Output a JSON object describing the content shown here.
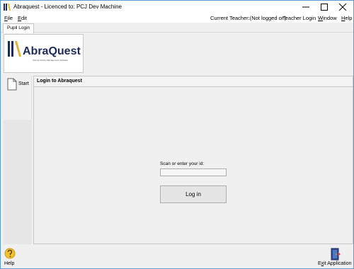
{
  "window": {
    "title": "Abraquest - Licenced to: PCJ Dev Machine"
  },
  "menu": {
    "file_rest": "ile",
    "file_mnemonic": "F",
    "edit_rest": "dit",
    "edit_mnemonic": "E",
    "current_teacher": "Current Teacher:(Not logged on)",
    "teacher_login": "Teacher Login",
    "window_rest": "indow",
    "window_mnemonic": "W",
    "help_rest": "elp",
    "help_mnemonic": "H"
  },
  "tabs": [
    {
      "label": "Pupil Login"
    }
  ],
  "logo": {
    "name": "AbraQuest",
    "tagline": "School Library Management Software"
  },
  "sidebar": {
    "start_label": "Start"
  },
  "panel": {
    "title": "Login to Abraquest"
  },
  "login": {
    "prompt": "Scan or enter your id:",
    "id_value": "",
    "button_label": "Log in"
  },
  "bottom": {
    "help_label": "Help",
    "exit_rest_before": "E",
    "exit_mnemonic": "x",
    "exit_rest_after": "it Application"
  },
  "colors": {
    "window_border": "#5b9bd5",
    "logo_navy": "#1d2a5c",
    "logo_gold": "#e2b23a",
    "help_icon": "#f2c12e"
  }
}
